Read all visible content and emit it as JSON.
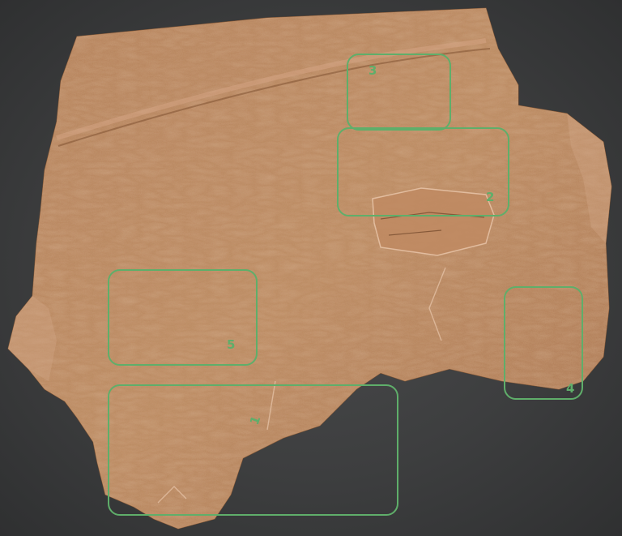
{
  "image": {
    "subject": "stone-tablet-fragment",
    "colors": {
      "background": "#3d3e3f",
      "stone": "#b8825a",
      "stone_dark": "#8a5a38",
      "stone_light": "#d9a47a",
      "annotation": "#5fae6a"
    }
  },
  "regions": [
    {
      "label": "1",
      "name": "region-1"
    },
    {
      "label": "2",
      "name": "region-2"
    },
    {
      "label": "3",
      "name": "region-3"
    },
    {
      "label": "4",
      "name": "region-4"
    },
    {
      "label": "5",
      "name": "region-5"
    }
  ]
}
